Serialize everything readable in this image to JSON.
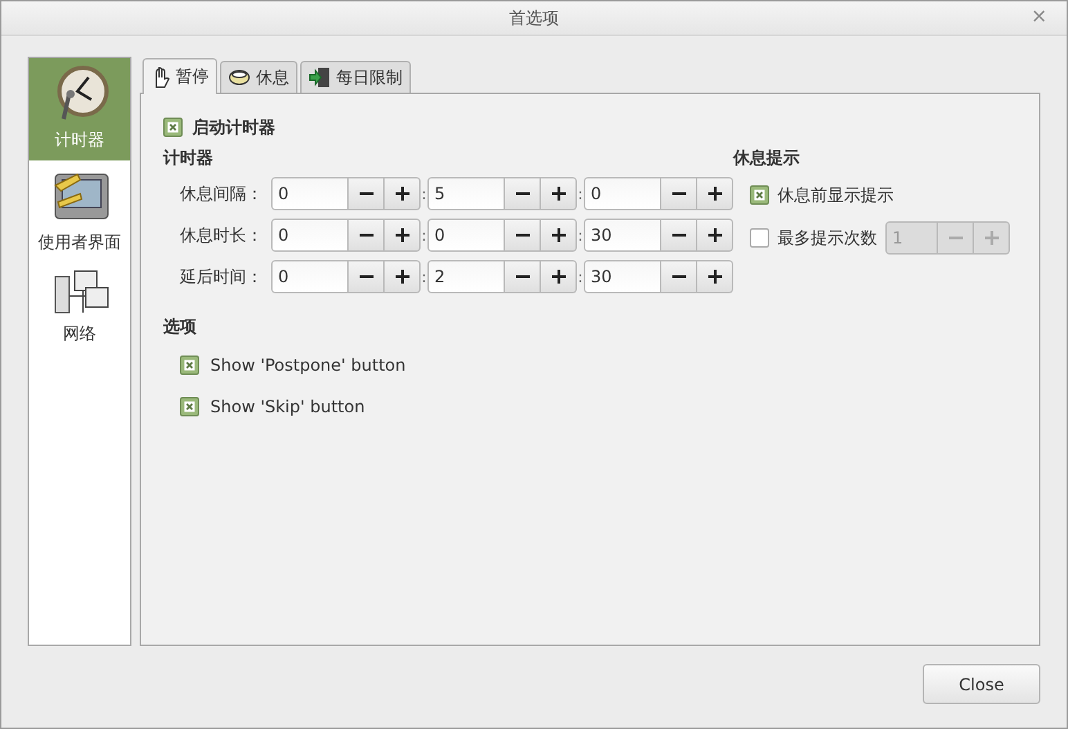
{
  "window": {
    "title": "首选项",
    "close": "×"
  },
  "sidebar": {
    "items": [
      {
        "label": "计时器",
        "kind": "clock",
        "selected": true
      },
      {
        "label": "使用者界面",
        "kind": "screen",
        "selected": false
      },
      {
        "label": "网络",
        "kind": "network",
        "selected": false
      }
    ]
  },
  "tabs": [
    {
      "label": "暂停",
      "kind": "hand",
      "selected": true
    },
    {
      "label": "休息",
      "kind": "cup",
      "selected": false
    },
    {
      "label": "每日限制",
      "kind": "exit",
      "selected": false
    }
  ],
  "enable_timer": {
    "label": "启动计时器",
    "checked": true
  },
  "timers": {
    "title": "计时器",
    "separator": ":",
    "rows": [
      {
        "label": "休息间隔：",
        "values": [
          "0",
          "5",
          "0"
        ]
      },
      {
        "label": "休息时长：",
        "values": [
          "0",
          "0",
          "30"
        ]
      },
      {
        "label": "延后时间：",
        "values": [
          "0",
          "2",
          "30"
        ]
      }
    ]
  },
  "break_notice": {
    "title": "休息提示",
    "items": [
      {
        "kind": "check",
        "label": "休息前显示提示",
        "checked": true
      },
      {
        "kind": "count",
        "label": "最多提示次数",
        "checked": false,
        "value": "1",
        "disabled": true
      }
    ]
  },
  "options": {
    "title": "选项",
    "items": [
      {
        "label": "Show 'Postpone' button",
        "checked": true
      },
      {
        "label": "Show 'Skip' button",
        "checked": true
      }
    ]
  },
  "buttons": [
    "Close"
  ]
}
